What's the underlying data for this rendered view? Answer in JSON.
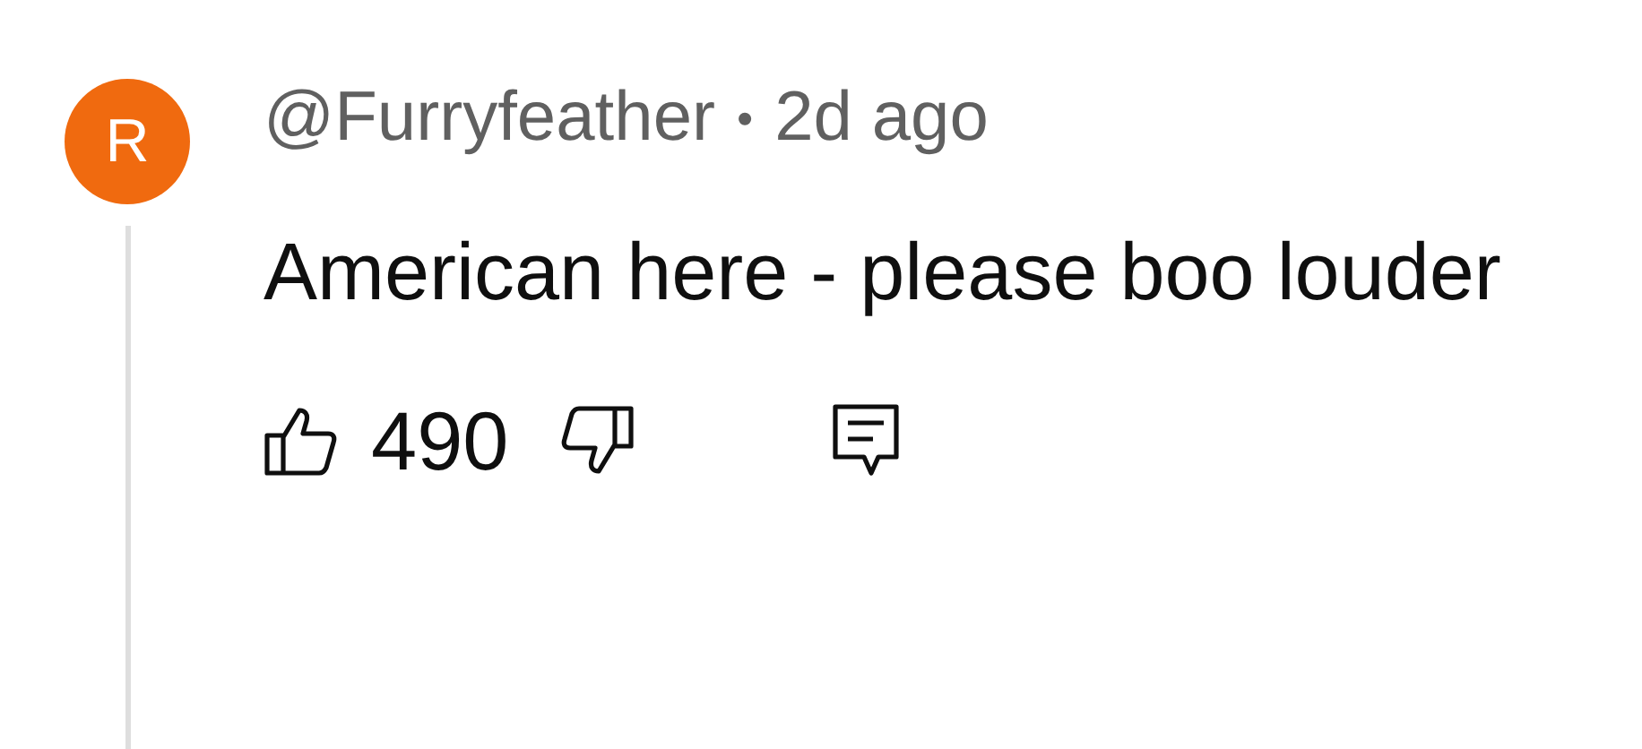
{
  "comment": {
    "avatar_letter": "R",
    "author": "@Furryfeather",
    "separator": "•",
    "time": "2d ago",
    "text": "American here - please boo louder",
    "likes": "490"
  }
}
